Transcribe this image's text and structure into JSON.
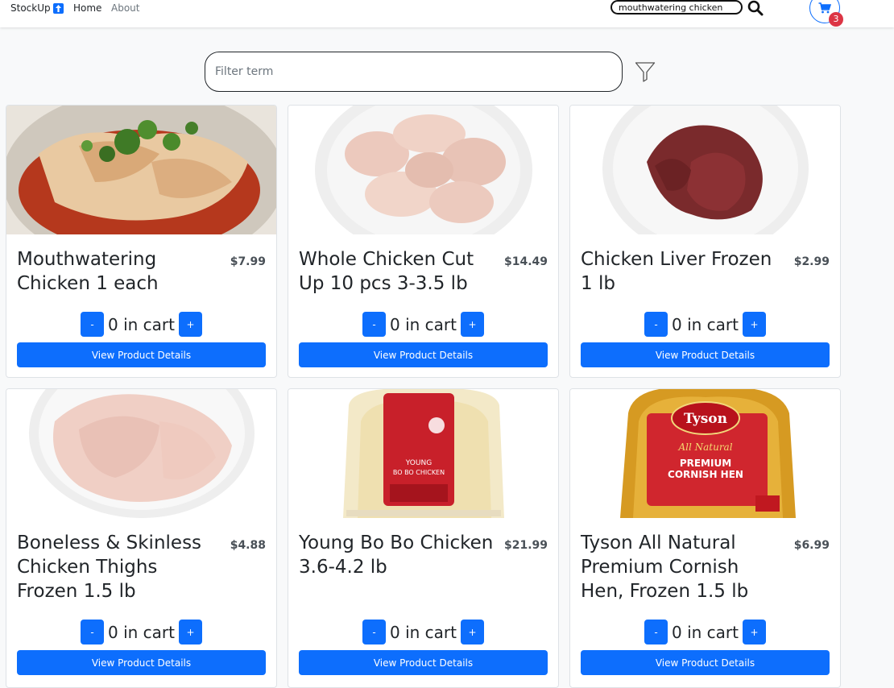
{
  "navbar": {
    "brand": "StockUp",
    "links": {
      "home": "Home",
      "about": "About"
    },
    "search_value": "mouthwatering chicken",
    "cart_count": "3"
  },
  "filter": {
    "placeholder": "Filter term"
  },
  "colors": {
    "primary": "#0d6efd",
    "badge": "#dc3545"
  },
  "products": [
    {
      "title": "Mouthwatering Chicken 1 each",
      "price": "$7.99",
      "qty_label": "0 in cart",
      "minus": "-",
      "plus": "+",
      "details": "View Product Details"
    },
    {
      "title": "Whole Chicken Cut Up 10 pcs 3-3.5 lb",
      "price": "$14.49",
      "qty_label": "0 in cart",
      "minus": "-",
      "plus": "+",
      "details": "View Product Details"
    },
    {
      "title": "Chicken Liver Frozen 1 lb",
      "price": "$2.99",
      "qty_label": "0 in cart",
      "minus": "-",
      "plus": "+",
      "details": "View Product Details"
    },
    {
      "title": "Boneless & Skinless Chicken Thighs Frozen 1.5 lb",
      "price": "$4.88",
      "qty_label": "0 in cart",
      "minus": "-",
      "plus": "+",
      "details": "View Product Details"
    },
    {
      "title": "Young Bo Bo Chicken 3.6-4.2 lb",
      "price": "$21.99",
      "qty_label": "0 in cart",
      "minus": "-",
      "plus": "+",
      "details": "View Product Details",
      "label_lines": [
        "YOUNG",
        "BO BO CHICKEN"
      ]
    },
    {
      "title": "Tyson All Natural Premium Cornish Hen, Frozen 1.5 lb",
      "price": "$6.99",
      "qty_label": "0 in cart",
      "minus": "-",
      "plus": "+",
      "details": "View Product Details",
      "label_lines": [
        "Tyson",
        "All Natural",
        "PREMIUM",
        "CORNISH HEN"
      ]
    }
  ]
}
